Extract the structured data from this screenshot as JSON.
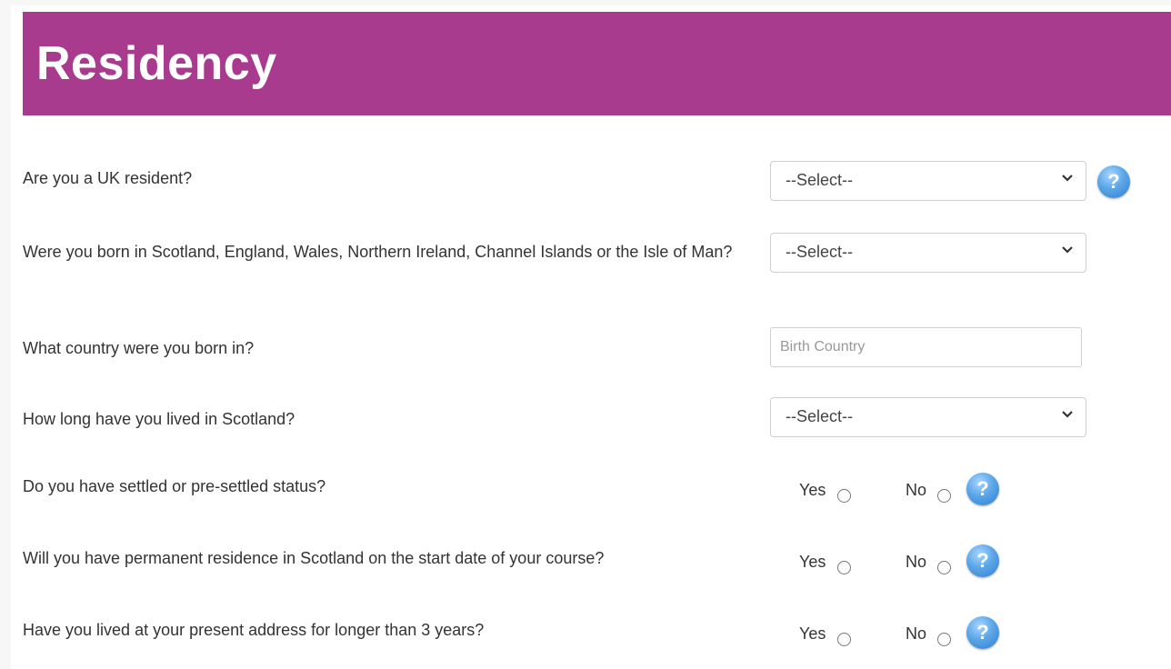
{
  "page": {
    "title": "Residency"
  },
  "questions": {
    "uk_resident": {
      "label": "Are you a UK resident?",
      "value": "--Select--"
    },
    "born_uk": {
      "label": "Were you born in Scotland, England, Wales, Northern Ireland, Channel Islands or the Isle of Man?",
      "value": "--Select--"
    },
    "birth_country": {
      "label": "What country were you born in?",
      "placeholder": "Birth Country"
    },
    "lived_scotland": {
      "label": "How long have you lived in Scotland?",
      "value": "--Select--"
    },
    "settled_status": {
      "label": "Do you have settled or pre-settled status?"
    },
    "permanent_residence": {
      "label": "Will you have permanent residence in Scotland on the start date of your course?"
    },
    "present_address": {
      "label": "Have you lived at your present address for longer than 3 years?"
    }
  },
  "radio_labels": {
    "yes": "Yes",
    "no": "No"
  },
  "help_glyph": "?",
  "icons": {
    "help": "question-circle-icon",
    "chevron": "chevron-down-icon"
  },
  "colors": {
    "header_bg": "#a83b8e",
    "header_text": "#ffffff",
    "help_blue": "#3b8ad9"
  }
}
